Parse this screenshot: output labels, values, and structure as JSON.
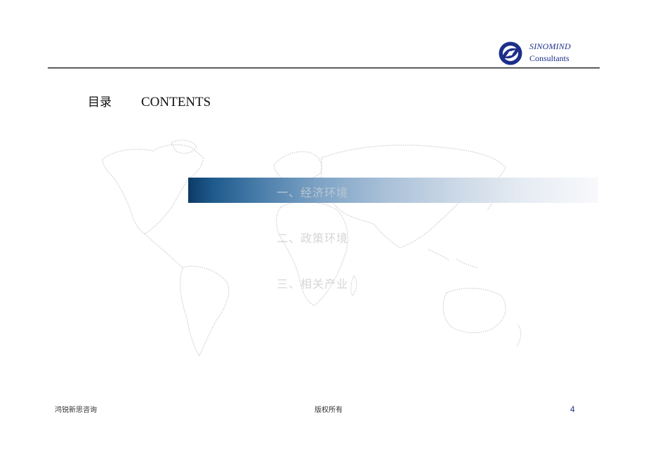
{
  "header": {
    "logo": {
      "name": "SINOMIND",
      "subtitle": "Consultants",
      "brand_color": "#1c2f8a"
    }
  },
  "title": {
    "cn": "目录",
    "en": "CONTENTS"
  },
  "toc": {
    "items": [
      {
        "label": "一、经济环境",
        "active": true
      },
      {
        "label": "二、政策环境",
        "active": false
      },
      {
        "label": "三、相关产业",
        "active": false
      }
    ],
    "highlight_colors": [
      "#0d3a66",
      "#f8f9fb"
    ]
  },
  "footer": {
    "left": "鸿锐新思咨询",
    "center": "版权所有",
    "page_number": "4"
  }
}
